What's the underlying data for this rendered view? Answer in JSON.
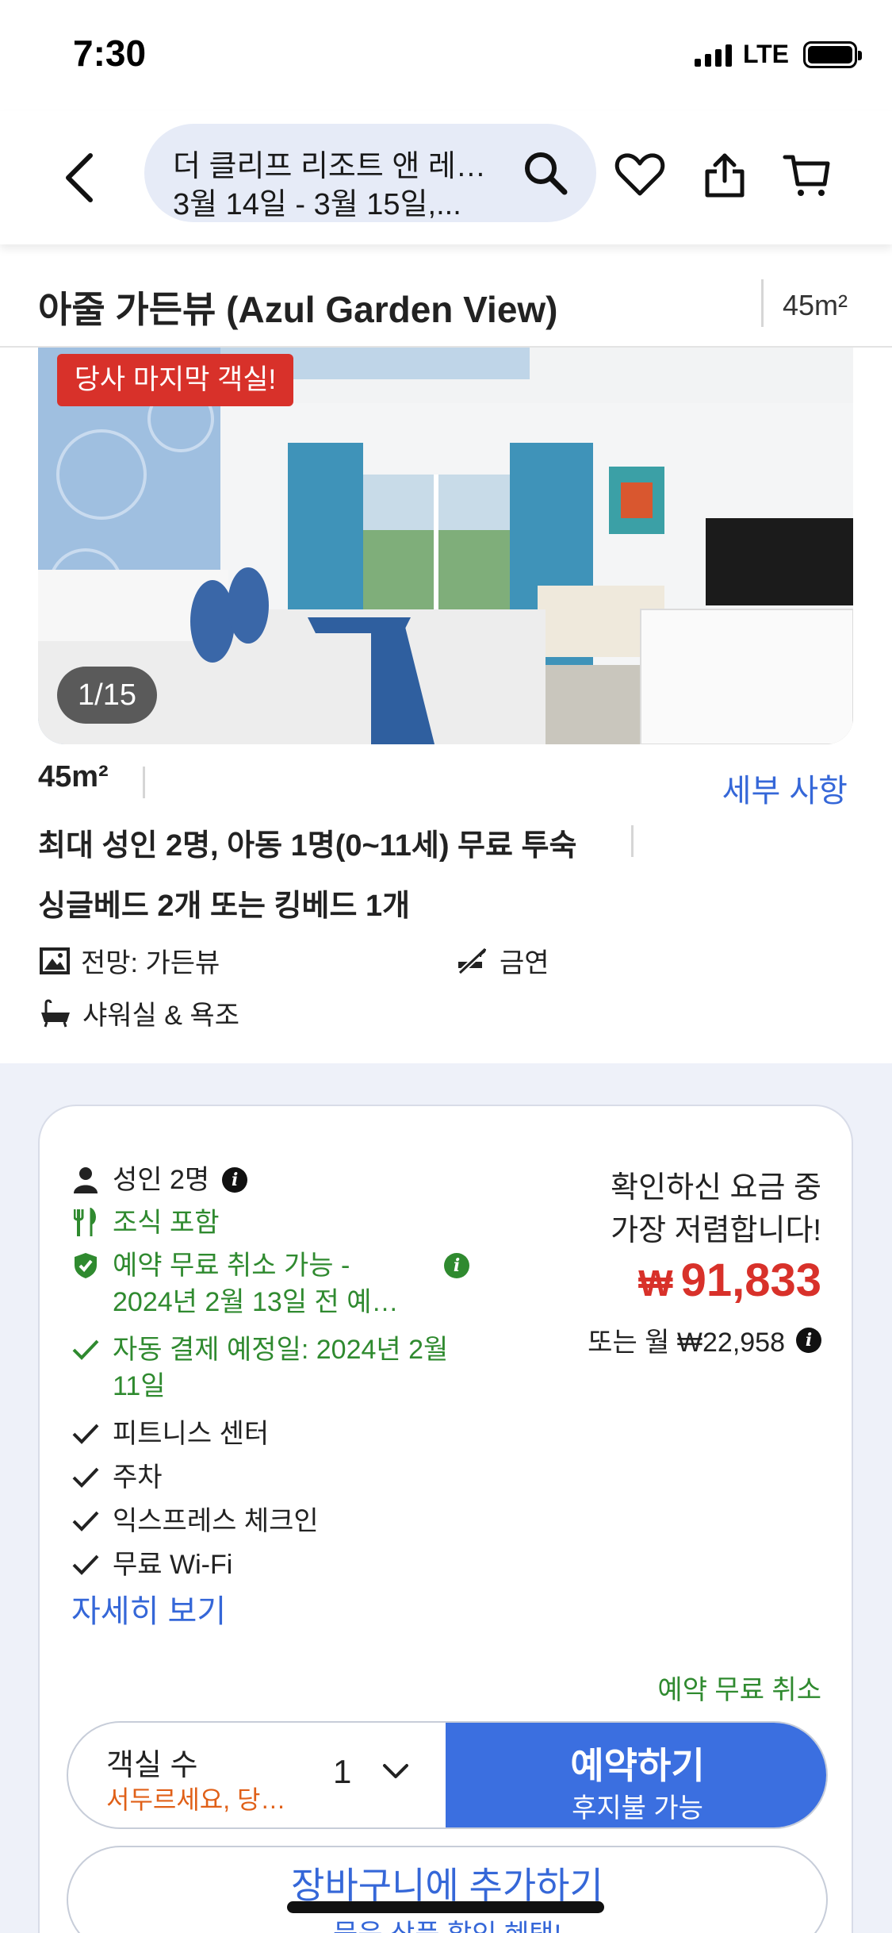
{
  "status_bar": {
    "time": "7:30",
    "network": "LTE"
  },
  "search": {
    "line1": "더 클리프 리조트 앤 레…",
    "line2": "3월 14일 - 3월 15일,..."
  },
  "room": {
    "title": "아줄 가든뷰 (Azul Garden View)",
    "header_size": "45m²",
    "badge": "당사 마지막 객실!",
    "photo_counter": "1/15",
    "size": "45m²",
    "details_link": "세부 사항",
    "occupancy": "최대 성인 2명, 아동 1명(0~11세) 무료 투숙",
    "beds": "싱글베드 2개 또는 킹베드 1개",
    "view": "전망: 가든뷰",
    "smoking": "금연",
    "bath": "샤워실 & 욕조"
  },
  "offer": {
    "guests": "성인 2명",
    "breakfast": "조식 포함",
    "cancel_line1": "예약 무료 취소 가능 -",
    "cancel_line2": "2024년 2월 13일 전 예…",
    "autopay_line1": "자동 결제 예정일: 2024년 2월",
    "autopay_line2": "11일",
    "amenities": [
      "피트니스 센터",
      "주차",
      "익스프레스 체크인",
      "무료 Wi-Fi"
    ],
    "more_link": "자세히 보기",
    "best_rate_line1": "확인하신 요금 중",
    "best_rate_line2": "가장 저렴합니다!",
    "currency_symbol": "₩",
    "price": "91,833",
    "monthly": "또는 월 ₩22,958",
    "free_cancel": "예약 무료 취소",
    "rooms_label": "객실 수",
    "rooms_hurry": "서두르세요, 당…",
    "rooms_qty": "1",
    "book_label": "예약하기",
    "book_sub": "후지불 가능",
    "cart_label": "장바구니에 추가하기",
    "cart_sub": "묶음 상품 할인 혜택!"
  },
  "colors": {
    "accent_blue": "#3b6fe0",
    "link_blue": "#3567d8",
    "price_red": "#d8312a",
    "green": "#2f8a2f",
    "hurry_orange": "#e06018",
    "section_bg": "#eef1f9"
  }
}
